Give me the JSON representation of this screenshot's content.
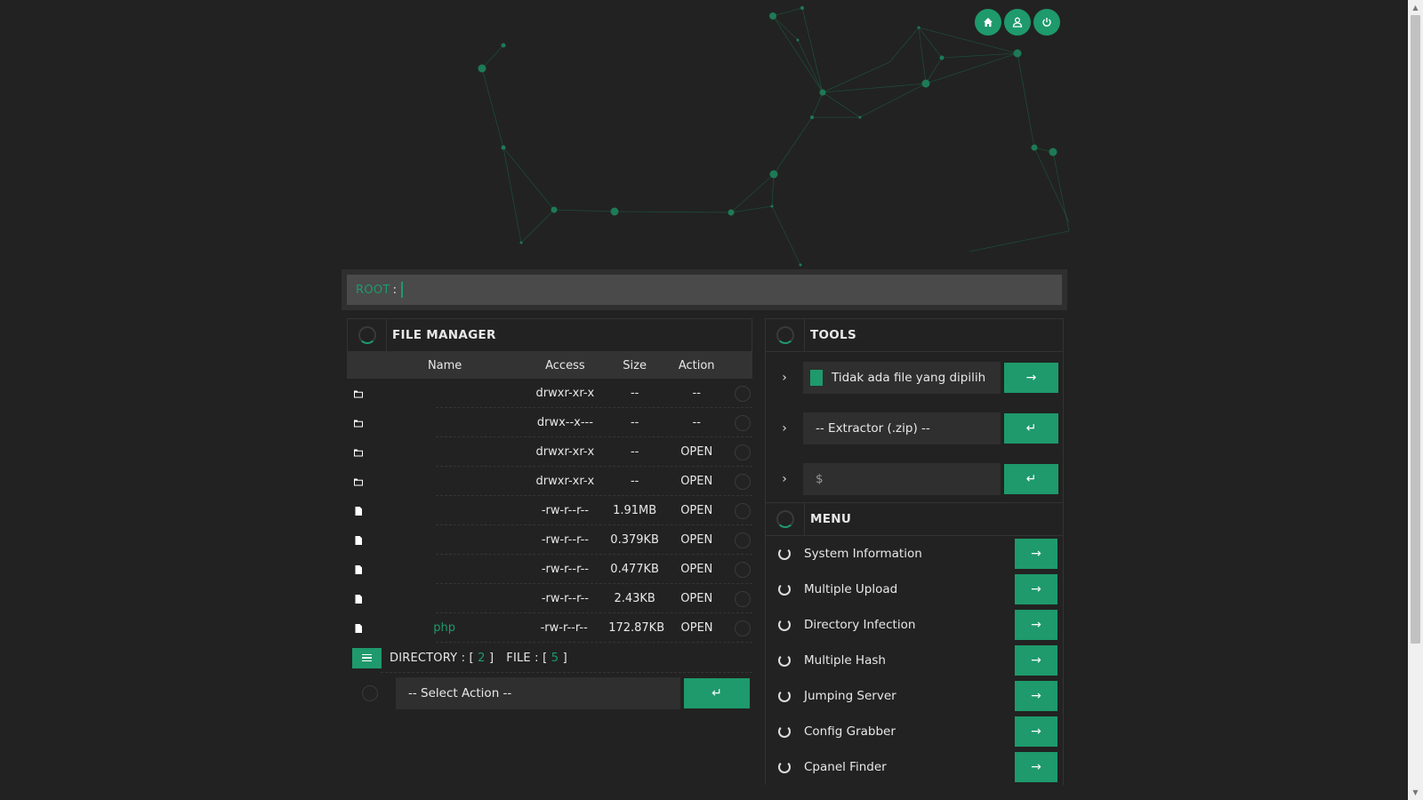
{
  "header": {
    "buttons": [
      {
        "name": "home-icon"
      },
      {
        "name": "user-icon"
      },
      {
        "name": "power-icon"
      }
    ]
  },
  "root": {
    "label": "ROOT",
    "colon": ":"
  },
  "file_manager": {
    "title": "FILE MANAGER",
    "columns": {
      "name": "Name",
      "access": "Access",
      "size": "Size",
      "action": "Action"
    },
    "rows": [
      {
        "type": "folder",
        "name": "",
        "access": "drwxr-xr-x",
        "size": "--",
        "action": "--"
      },
      {
        "type": "folder",
        "name": "",
        "access": "drwx--x---",
        "size": "--",
        "action": "--"
      },
      {
        "type": "folder",
        "name": "",
        "access": "drwxr-xr-x",
        "size": "--",
        "action": "OPEN"
      },
      {
        "type": "folder",
        "name": "",
        "access": "drwxr-xr-x",
        "size": "--",
        "action": "OPEN"
      },
      {
        "type": "file",
        "name": "",
        "access": "-rw-r--r--",
        "size": "1.91MB",
        "action": "OPEN"
      },
      {
        "type": "file",
        "name": "",
        "access": "-rw-r--r--",
        "size": "0.379KB",
        "action": "OPEN"
      },
      {
        "type": "file",
        "name": "",
        "access": "-rw-r--r--",
        "size": "0.477KB",
        "action": "OPEN"
      },
      {
        "type": "file",
        "name": "",
        "access": "-rw-r--r--",
        "size": "2.43KB",
        "action": "OPEN"
      },
      {
        "type": "file",
        "name": "php",
        "access": "-rw-r--r--",
        "size": "172.87KB",
        "action": "OPEN"
      }
    ],
    "summary": {
      "directory_label": "DIRECTORY :",
      "directory_count": "2",
      "file_label": "FILE :",
      "file_count": "5",
      "open_bracket": "[",
      "close_bracket": "]"
    },
    "select_action": "-- Select Action --",
    "submit_icon": "↵"
  },
  "tools": {
    "title": "TOOLS",
    "upload_text": "Tidak ada file yang dipilih",
    "upload_button": "→",
    "extractor": "-- Extractor (.zip) --",
    "extractor_button": "↵",
    "command_placeholder": "$",
    "command_button": "↵",
    "chevron": "›"
  },
  "menu": {
    "title": "MENU",
    "items": [
      {
        "label": "System Information",
        "button": "→"
      },
      {
        "label": "Multiple Upload",
        "button": "→"
      },
      {
        "label": "Directory Infection",
        "button": "→"
      },
      {
        "label": "Multiple Hash",
        "button": "→"
      },
      {
        "label": "Jumping Server",
        "button": "→"
      },
      {
        "label": "Config Grabber",
        "button": "→"
      },
      {
        "label": "Cpanel Finder",
        "button": "→"
      }
    ]
  },
  "colors": {
    "accent": "#1e9a6c",
    "background": "#222222",
    "panel": "#2f2f2f"
  }
}
